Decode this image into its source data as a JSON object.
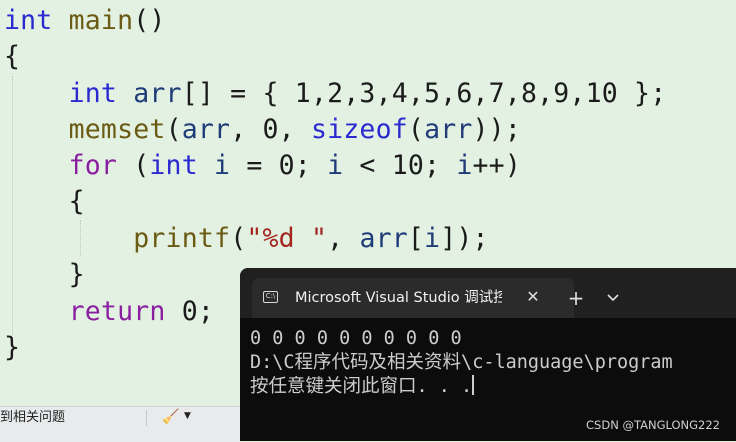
{
  "editor": {
    "lines": [
      [
        {
          "t": "int",
          "c": "kw"
        },
        {
          "t": " "
        },
        {
          "t": "main",
          "c": "fn"
        },
        {
          "t": "()"
        }
      ],
      [
        {
          "t": "{"
        }
      ],
      [
        {
          "t": "    "
        },
        {
          "t": "int",
          "c": "kw"
        },
        {
          "t": " "
        },
        {
          "t": "arr",
          "c": "id"
        },
        {
          "t": "[] = { 1,2,3,4,5,6,7,8,9,10 };"
        }
      ],
      [
        {
          "t": "    "
        },
        {
          "t": "memset",
          "c": "fn"
        },
        {
          "t": "("
        },
        {
          "t": "arr",
          "c": "id"
        },
        {
          "t": ", 0, "
        },
        {
          "t": "sizeof",
          "c": "kw"
        },
        {
          "t": "("
        },
        {
          "t": "arr",
          "c": "id"
        },
        {
          "t": "));"
        }
      ],
      [
        {
          "t": "    "
        },
        {
          "t": "for",
          "c": "kw2"
        },
        {
          "t": " ("
        },
        {
          "t": "int",
          "c": "kw"
        },
        {
          "t": " "
        },
        {
          "t": "i",
          "c": "id"
        },
        {
          "t": " = 0; "
        },
        {
          "t": "i",
          "c": "id"
        },
        {
          "t": " < 10; "
        },
        {
          "t": "i",
          "c": "id"
        },
        {
          "t": "++)"
        }
      ],
      [
        {
          "t": "    {"
        }
      ],
      [
        {
          "t": "        "
        },
        {
          "t": "printf",
          "c": "fn"
        },
        {
          "t": "("
        },
        {
          "t": "\"%d \"",
          "c": "str"
        },
        {
          "t": ", "
        },
        {
          "t": "arr",
          "c": "id"
        },
        {
          "t": "["
        },
        {
          "t": "i",
          "c": "id"
        },
        {
          "t": "]);"
        }
      ],
      [
        {
          "t": "    }"
        }
      ],
      [
        {
          "t": "    "
        },
        {
          "t": "return",
          "c": "kw2"
        },
        {
          "t": " 0;"
        }
      ],
      [
        {
          "t": "}"
        }
      ]
    ]
  },
  "status_bar": {
    "problems_label": "到相关问题"
  },
  "terminal": {
    "tab_title": "Microsoft Visual Studio 调试控制台",
    "tab_icon": "C:\\",
    "close_glyph": "✕",
    "new_tab_glyph": "+",
    "output_lines": [
      "0 0 0 0 0 0 0 0 0 0",
      "D:\\C程序代码及相关资料\\c-language\\program",
      "按任意键关闭此窗口. . ."
    ]
  },
  "watermark": "CSDN @TANGLONG222",
  "icons": {
    "terminal": "cmd-terminal-icon",
    "close": "close-icon",
    "new_tab": "plus-icon",
    "dropdown": "chevron-down-icon",
    "format": "brush-icon"
  }
}
